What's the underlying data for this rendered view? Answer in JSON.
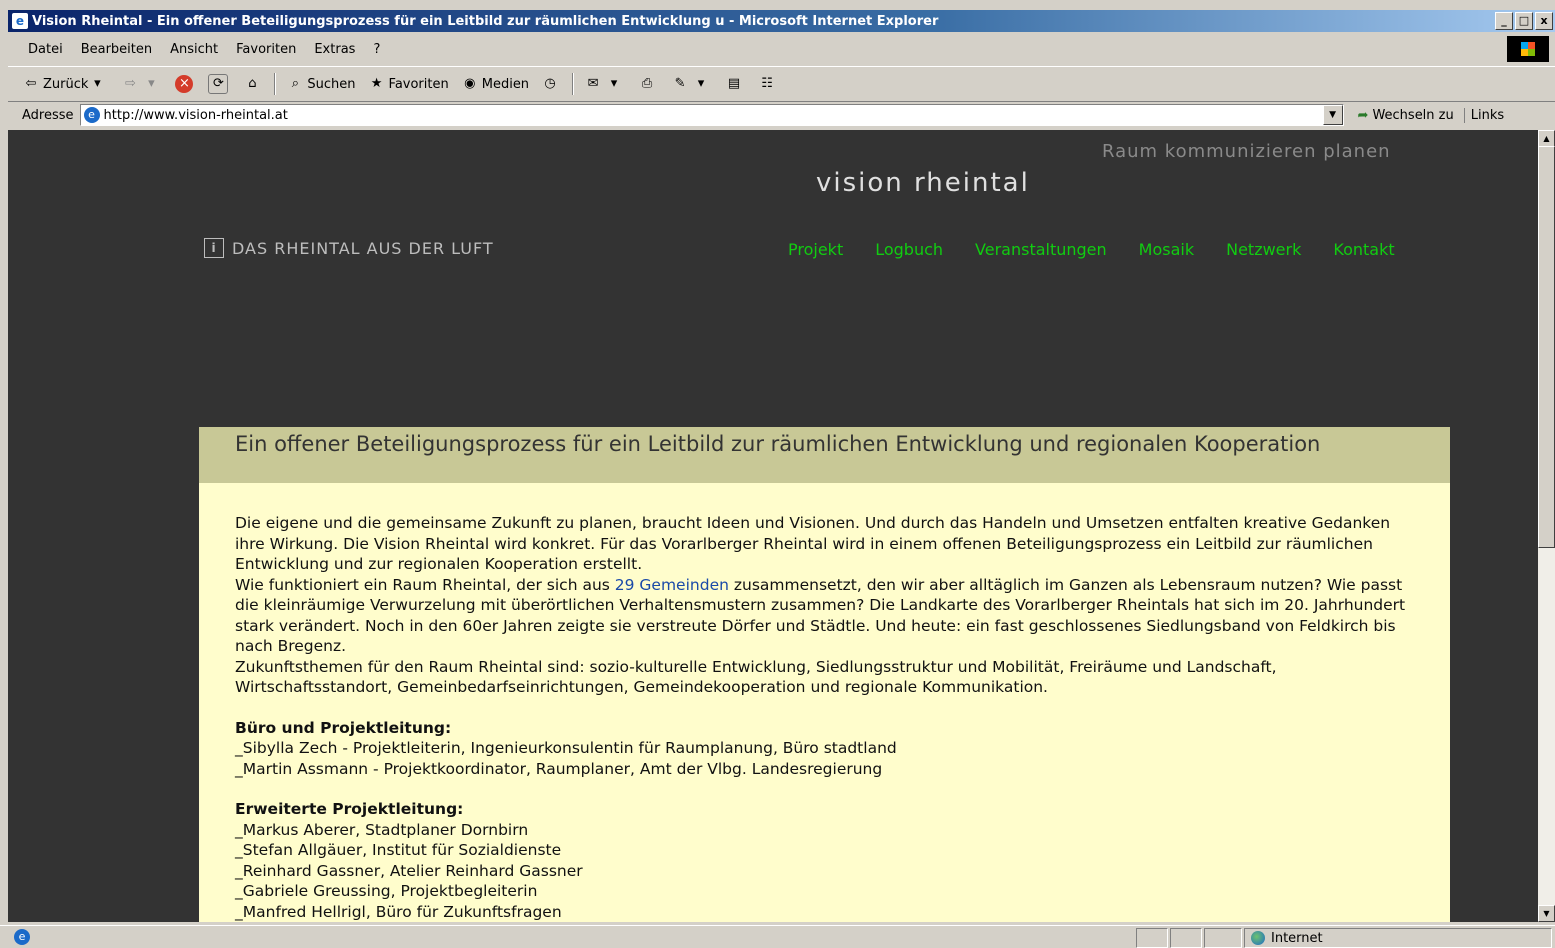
{
  "window": {
    "title": "Vision Rheintal - Ein offener Beteiligungsprozess für ein Leitbild zur räumlichen Entwicklung u - Microsoft Internet Explorer",
    "controls": {
      "minimize": "_",
      "maximize": "□",
      "close": "x"
    }
  },
  "menu": [
    "Datei",
    "Bearbeiten",
    "Ansicht",
    "Favoriten",
    "Extras",
    "?"
  ],
  "toolbar": {
    "back_label": "Zurück",
    "search_label": "Suchen",
    "favorites_label": "Favoriten",
    "media_label": "Medien"
  },
  "address": {
    "label": "Adresse",
    "url": "http://www.vision-rheintal.at",
    "go_label": "Wechseln zu",
    "links_label": "Links"
  },
  "page": {
    "tagline": "Raum kommunizieren planen",
    "logo": "vision rheintal",
    "info_icon": "i",
    "info_link": "DAS RHEINTAL AUS DER LUFT",
    "nav": [
      "Projekt",
      "Logbuch",
      "Veranstaltungen",
      "Mosaik",
      "Netzwerk",
      "Kontakt"
    ],
    "heading": "Ein offener Beteiligungsprozess für ein Leitbild zur räumlichen Entwicklung und regionalen Kooperation",
    "intro": "Die eigene und die gemeinsame Zukunft zu planen, braucht Ideen und Visionen. Und durch das Handeln und Umsetzen entfalten kreative Gedanken ihre Wirkung. Die Vision Rheintal wird konkret. Für das Vorarlberger Rheintal wird in einem offenen Beteiligungsprozess ein Leitbild zur räumlichen Entwicklung und zur regionalen Kooperation erstellt.",
    "question_pre": "Wie funktioniert ein Raum Rheintal, der sich aus ",
    "question_link": "29 Gemeinden",
    "question_post": " zusammensetzt, den wir aber alltäglich im Ganzen als Lebensraum nutzen? Wie passt die kleinräumige Verwurzelung mit überörtlichen Verhaltensmustern zusammen? Die Landkarte des Vorarlberger Rheintals hat sich im 20. Jahrhundert stark verändert. Noch in den 60er Jahren zeigte sie verstreute Dörfer und Städtle. Und heute: ein fast geschlossenes Siedlungsband von Feldkirch bis nach Bregenz.",
    "themes": "Zukunftsthemen für den Raum Rheintal sind: sozio-kulturelle Entwicklung, Siedlungsstruktur und Mobilität, Freiräume und Landschaft, Wirtschaftsstandort, Gemeinbedarfseinrichtungen, Gemeindekooperation und regionale Kommunikation.",
    "section1_title": "Büro und Projektleitung:",
    "section1_items": [
      "_Sibylla Zech - Projektleiterin, Ingenieurkonsulentin für Raumplanung, Büro stadtland",
      "_Martin Assmann - Projektkoordinator, Raumplaner, Amt der Vlbg. Landesregierung"
    ],
    "section2_title": "Erweiterte Projektleitung:",
    "section2_items": [
      "_Markus Aberer, Stadtplaner Dornbirn",
      "_Stefan Allgäuer, Institut für Sozialdienste",
      "_Reinhard Gassner, Atelier Reinhard Gassner",
      "_Gabriele Greussing, Projektbegleiterin",
      "_Manfred Hellrigl, Büro für Zukunftsfragen"
    ]
  },
  "status": {
    "zone": "Internet"
  }
}
